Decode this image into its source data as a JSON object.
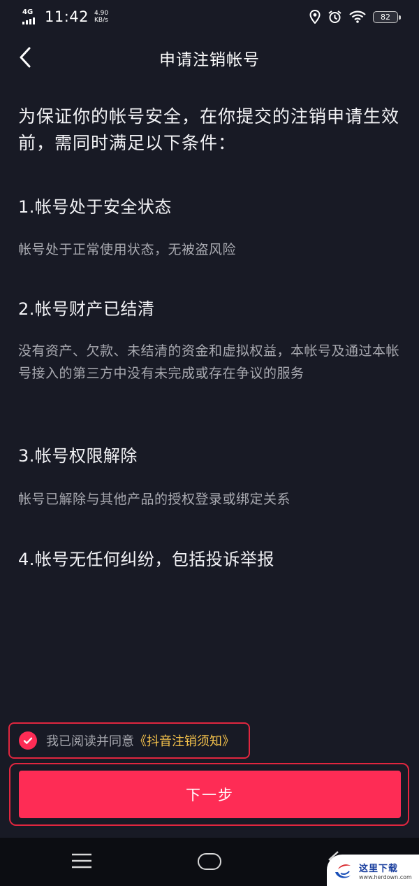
{
  "status_bar": {
    "network_type": "4G",
    "time": "11:42",
    "speed_value": "4.90",
    "speed_unit": "KB/s",
    "battery": "82",
    "icons": [
      "signal-icon",
      "location-icon",
      "alarm-icon",
      "wifi-icon",
      "battery-icon"
    ]
  },
  "nav": {
    "title": "申请注销帐号",
    "back_icon": "chevron-left-icon"
  },
  "content": {
    "intro": "为保证你的帐号安全，在你提交的注销申请生效前，需同时满足以下条件：",
    "conditions": [
      {
        "title": "1.帐号处于安全状态",
        "desc": "帐号处于正常使用状态，无被盗风险"
      },
      {
        "title": "2.帐号财产已结清",
        "desc": "没有资产、欠款、未结清的资金和虚拟权益，本帐号及通过本帐号接入的第三方中没有未完成或存在争议的服务"
      },
      {
        "title": "3.帐号权限解除",
        "desc": "帐号已解除与其他产品的授权登录或绑定关系"
      },
      {
        "title": "4.帐号无任何纠纷，包括投诉举报",
        "desc": ""
      }
    ]
  },
  "agreement": {
    "checked": true,
    "prefix": "我已阅读并同意",
    "link": "《抖音注销须知》"
  },
  "next_button": {
    "label": "下一步"
  },
  "system_nav": {
    "icons": [
      "menu-icon",
      "home-icon",
      "back-icon"
    ]
  },
  "watermark": {
    "cn": "这里下载",
    "url": "www.herdown.com"
  },
  "colors": {
    "background": "#181a25",
    "accent": "#fe2c55",
    "link": "#f5c24b",
    "annotation": "#e0263f"
  }
}
